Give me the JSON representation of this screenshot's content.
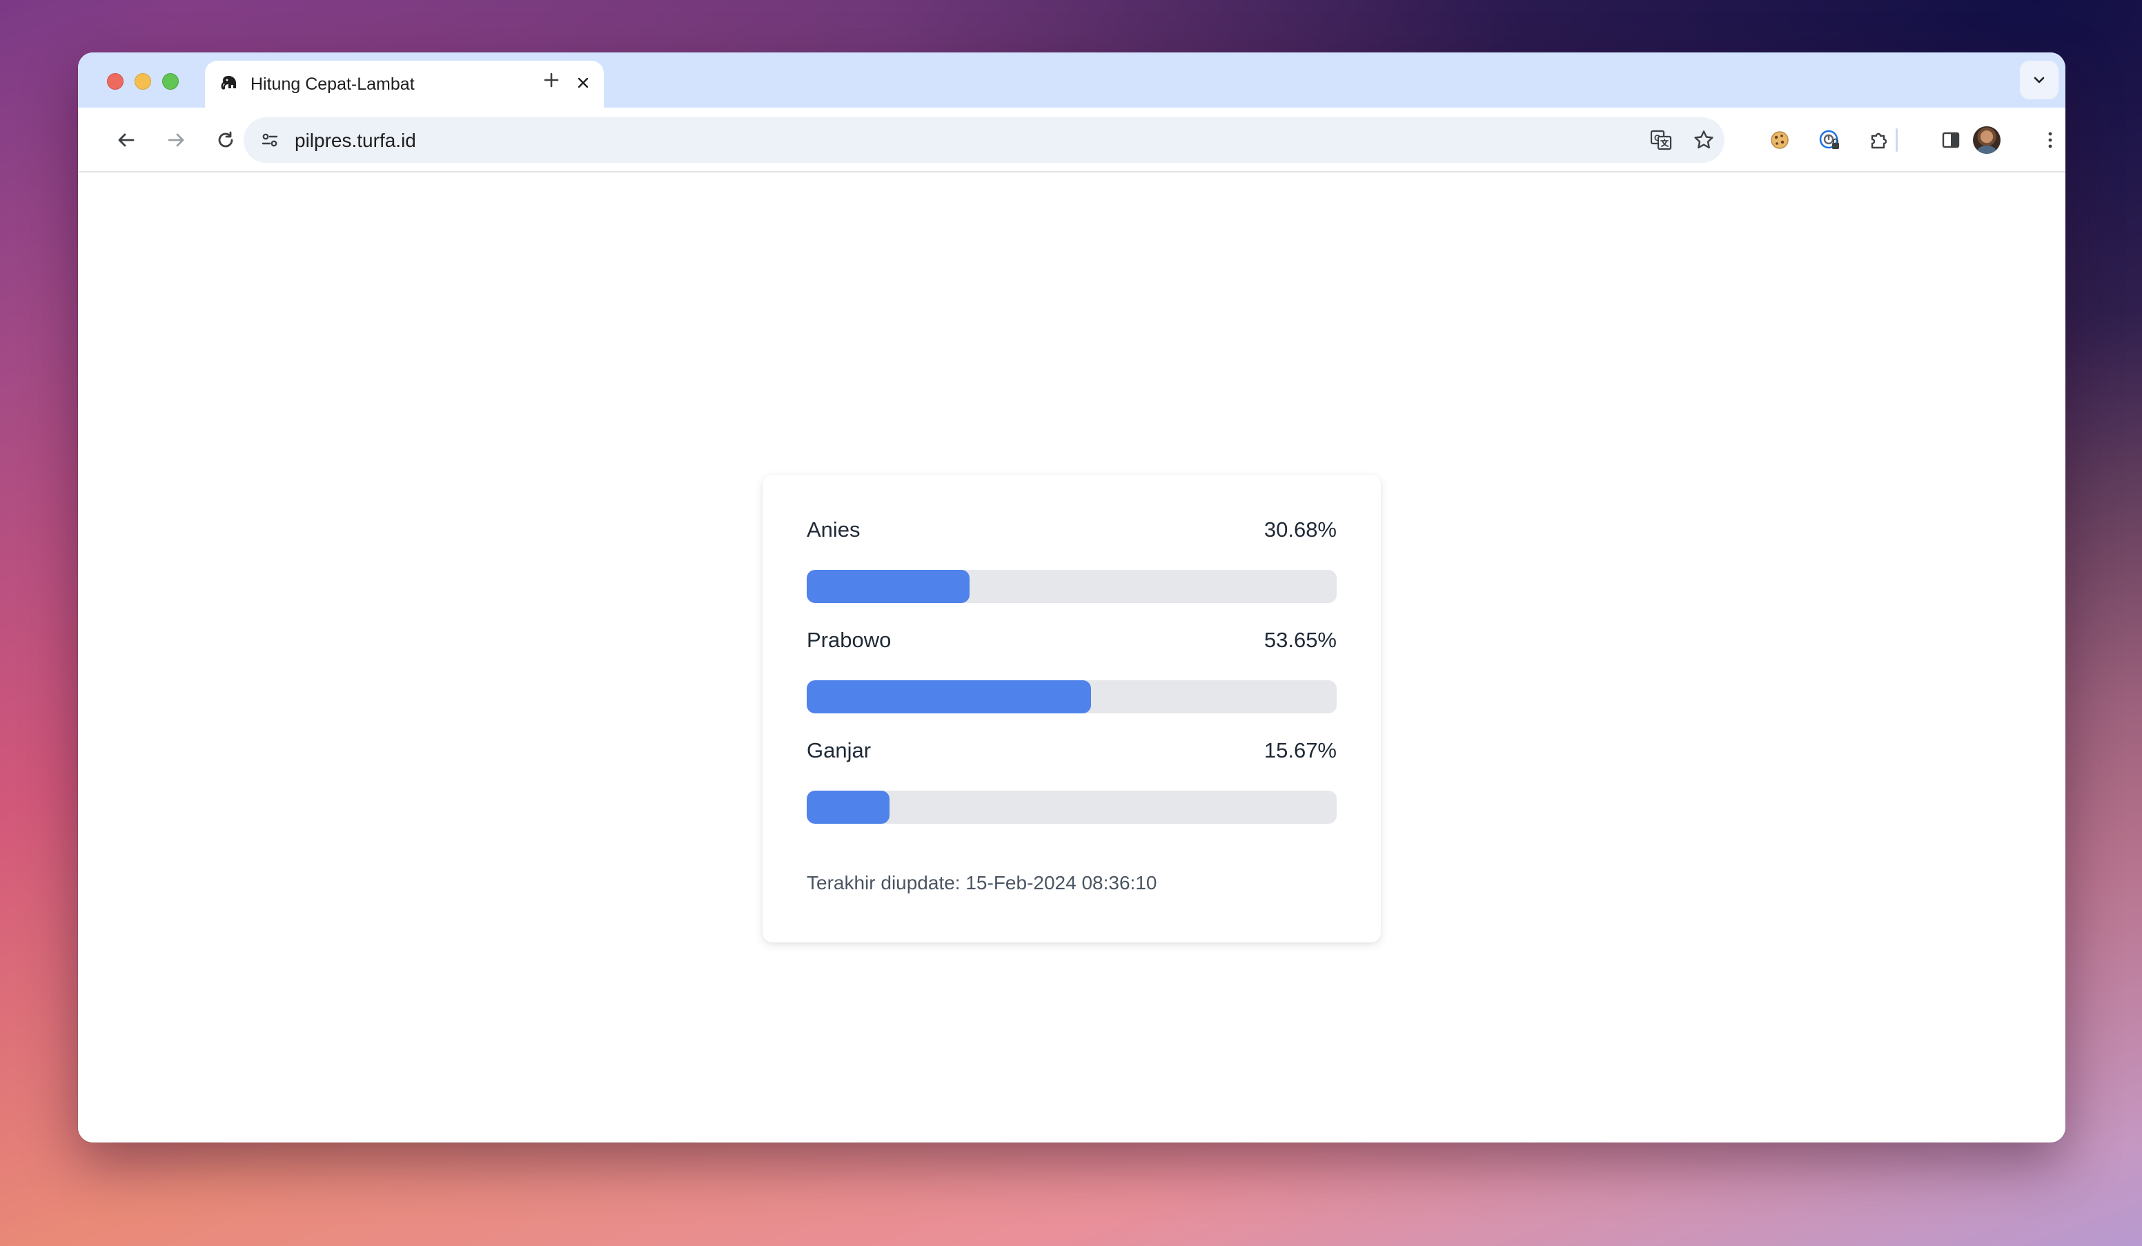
{
  "browser": {
    "tab": {
      "title": "Hitung Cepat-Lambat",
      "favicon": "elephant-icon"
    },
    "url": "pilpres.turfa.id"
  },
  "results": [
    {
      "name": "Anies",
      "percent_label": "30.68%",
      "percent": 30.68
    },
    {
      "name": "Prabowo",
      "percent_label": "53.65%",
      "percent": 53.65
    },
    {
      "name": "Ganjar",
      "percent_label": "15.67%",
      "percent": 15.67
    }
  ],
  "last_updated": "Terakhir diupdate: 15-Feb-2024 08:36:10",
  "colors": {
    "bar_fill": "#4f82ea",
    "bar_track": "#e5e7eb",
    "tab_strip": "#d3e3fd"
  }
}
